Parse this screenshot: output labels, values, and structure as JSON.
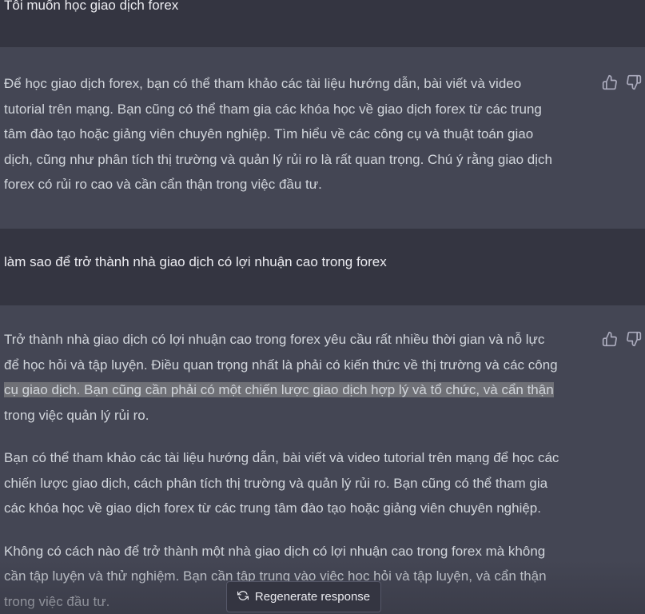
{
  "messages": [
    {
      "role": "user",
      "text": "Tôi muốn học giao dịch forex"
    },
    {
      "role": "assistant",
      "lines": [
        "Để học giao dịch forex, bạn có thể tham khảo các tài liệu hướng dẫn, bài viết và video",
        "tutorial trên mạng. Bạn cũng có thể tham gia các khóa học về giao dịch forex từ các trung",
        "tâm đào tạo hoặc giảng viên chuyên nghiệp. Tìm hiểu về các công cụ và thuật toán giao",
        "dịch, cũng như phân tích thị trường và quản lý rủi ro là rất quan trọng. Chú ý rằng giao dịch",
        "forex có rủi ro cao và cần cẩn thận trong việc đầu tư."
      ]
    },
    {
      "role": "user",
      "text": "làm sao để trở thành nhà giao dịch có lợi nhuận cao trong forex"
    },
    {
      "role": "assistant",
      "paragraphs": [
        {
          "line1": "Trở thành nhà giao dịch có lợi nhuận cao trong forex yêu cầu rất nhiều thời gian và nỗ lực",
          "line2": "để học hỏi và tập luyện. Điều quan trọng nhất là phải có kiến thức về thị trường và các công",
          "line3": "cụ giao dịch. Bạn cũng cần phải có một chiến lược giao dịch hợp lý và tổ chức, và cẩn thận",
          "line4": "trong việc quản lý rủi ro."
        },
        {
          "line1": "Bạn có thể tham khảo các tài liệu hướng dẫn, bài viết và video tutorial trên mạng để học các",
          "line2": "chiến lược giao dịch, cách phân tích thị trường và quản lý rủi ro. Bạn cũng có thể tham gia",
          "line3": "các khóa học về giao dịch forex từ các trung tâm đào tạo hoặc giảng viên chuyên nghiệp."
        },
        {
          "line1": "Không có cách nào để trở thành một nhà giao dịch có lợi nhuận cao trong forex mà không",
          "line2": "cần tập luyện và thử nghiệm. Bạn cần tập trung vào việc học hỏi và tập luyện, và cẩn thận",
          "line3": "trong việc đầu tư."
        }
      ]
    }
  ],
  "icons": {
    "thumbs_up": "thumbs-up-icon",
    "thumbs_down": "thumbs-down-icon",
    "regenerate": "refresh-icon"
  },
  "regenerate_button": {
    "label": "Regenerate response"
  },
  "colors": {
    "user_row_bg": "#343541",
    "assistant_row_bg": "#444654",
    "highlight": "#6f7076"
  }
}
